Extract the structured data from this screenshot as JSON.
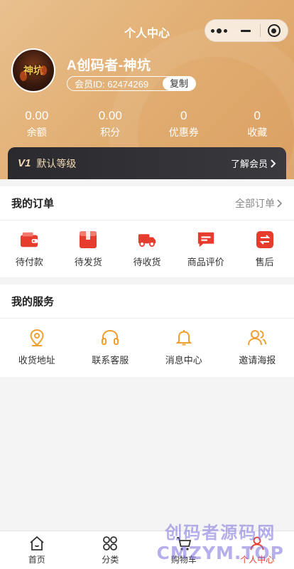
{
  "nav": {
    "title": "个人中心"
  },
  "profile": {
    "username": "A创码者-神坑",
    "member_id_label": "会员ID: 62474269",
    "copy_label": "复制",
    "avatar_text": "神坑"
  },
  "stats": [
    {
      "value": "0.00",
      "label": "余额"
    },
    {
      "value": "0.00",
      "label": "积分"
    },
    {
      "value": "0",
      "label": "优惠券"
    },
    {
      "value": "0",
      "label": "收藏"
    }
  ],
  "vip": {
    "badge": "V1",
    "level": "默认等级",
    "more": "了解会员"
  },
  "orders": {
    "title": "我的订单",
    "all_label": "全部订单",
    "items": [
      {
        "label": "待付款",
        "icon": "wallet-icon"
      },
      {
        "label": "待发货",
        "icon": "package-icon"
      },
      {
        "label": "待收货",
        "icon": "truck-icon"
      },
      {
        "label": "商品评价",
        "icon": "comment-icon"
      },
      {
        "label": "售后",
        "icon": "exchange-icon"
      }
    ]
  },
  "services": {
    "title": "我的服务",
    "items": [
      {
        "label": "收货地址",
        "icon": "location-icon"
      },
      {
        "label": "联系客服",
        "icon": "headset-icon"
      },
      {
        "label": "消息中心",
        "icon": "bell-icon"
      },
      {
        "label": "邀请海报",
        "icon": "users-icon"
      }
    ]
  },
  "tabbar": {
    "items": [
      {
        "label": "首页",
        "icon": "home-icon"
      },
      {
        "label": "分类",
        "icon": "category-icon"
      },
      {
        "label": "购物车",
        "icon": "cart-icon"
      },
      {
        "label": "个人中心",
        "icon": "user-icon",
        "active": true
      }
    ]
  },
  "watermark": {
    "line1": "创码者源码网",
    "line2": "CMZYM.TOP"
  },
  "colors": {
    "accent_red": "#e63c2e",
    "header_gold": "#e0ac70",
    "service_orange": "#f0a030",
    "vip_dark": "#2a2a2e"
  }
}
